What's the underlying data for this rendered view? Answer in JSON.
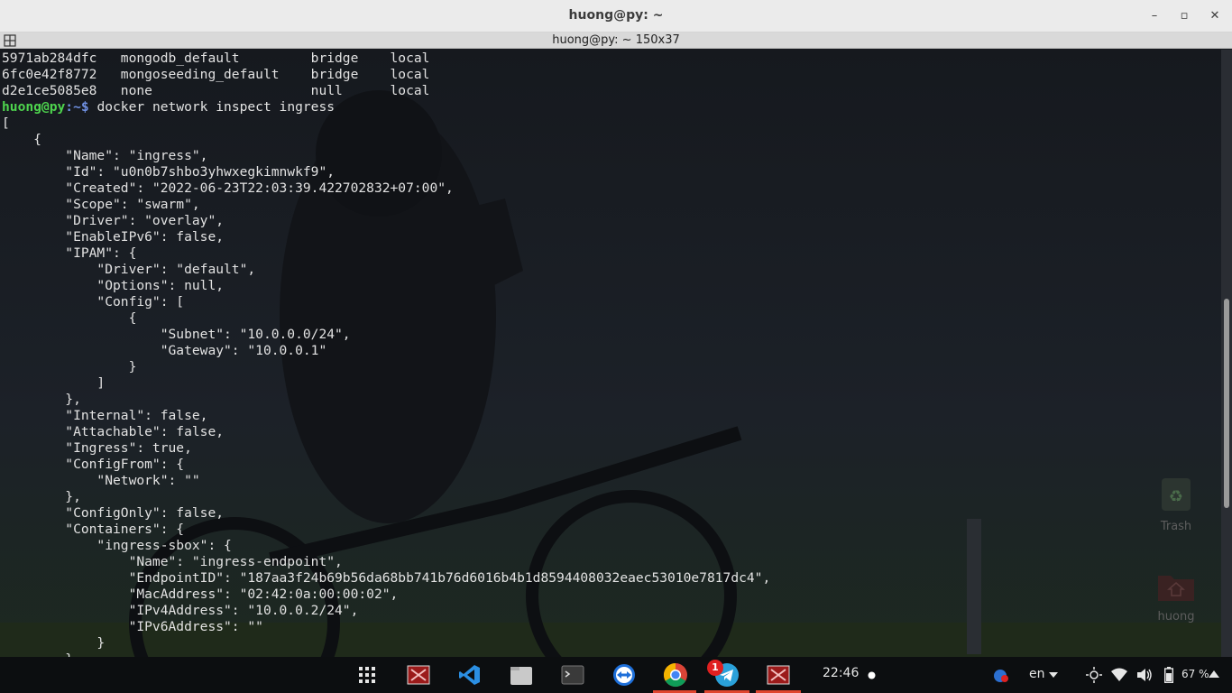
{
  "window": {
    "title": "huong@py: ~",
    "subtitle": "huong@py: ~ 150x37"
  },
  "terminal": {
    "prompt_user": "huong@py",
    "prompt_path": ":~$ ",
    "command": "docker network inspect ingress",
    "lines_before": [
      "5971ab284dfc   mongodb_default         bridge    local",
      "6fc0e42f8772   mongoseeding_default    bridge    local",
      "d2e1ce5085e8   none                    null      local"
    ],
    "lines_after": [
      "[",
      "    {",
      "        \"Name\": \"ingress\",",
      "        \"Id\": \"u0n0b7shbo3yhwxegkimnwkf9\",",
      "        \"Created\": \"2022-06-23T22:03:39.422702832+07:00\",",
      "        \"Scope\": \"swarm\",",
      "        \"Driver\": \"overlay\",",
      "        \"EnableIPv6\": false,",
      "        \"IPAM\": {",
      "            \"Driver\": \"default\",",
      "            \"Options\": null,",
      "            \"Config\": [",
      "                {",
      "                    \"Subnet\": \"10.0.0.0/24\",",
      "                    \"Gateway\": \"10.0.0.1\"",
      "                }",
      "            ]",
      "        },",
      "        \"Internal\": false,",
      "        \"Attachable\": false,",
      "        \"Ingress\": true,",
      "        \"ConfigFrom\": {",
      "            \"Network\": \"\"",
      "        },",
      "        \"ConfigOnly\": false,",
      "        \"Containers\": {",
      "            \"ingress-sbox\": {",
      "                \"Name\": \"ingress-endpoint\",",
      "                \"EndpointID\": \"187aa3f24b69b56da68bb741b76d6016b4b1d8594408032eaec53010e7817dc4\",",
      "                \"MacAddress\": \"02:42:0a:00:00:02\",",
      "                \"IPv4Address\": \"10.0.0.2/24\",",
      "                \"IPv6Address\": \"\"",
      "            }",
      "        },"
    ]
  },
  "desktop": {
    "trash_label": "Trash",
    "home_label": "huong"
  },
  "taskbar": {
    "clock": "22:46",
    "language": "en",
    "battery": "67 %",
    "telegram_badge": "1"
  },
  "colors": {
    "prompt_user": "#4ed44e",
    "prompt_path": "#6f8fe0",
    "terminal_text": "#e2e2e2",
    "active_indicator": "#e0452f"
  }
}
